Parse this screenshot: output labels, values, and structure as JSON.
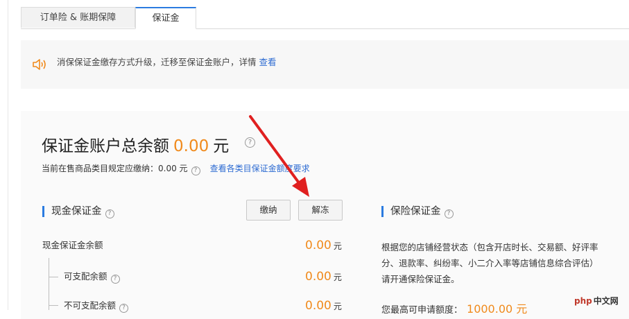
{
  "tabs": [
    {
      "label": "订单险 & 账期保障",
      "active": false
    },
    {
      "label": "保证金",
      "active": true
    }
  ],
  "notice": {
    "text": "消保保证金缴存方式升级，迁移至保证金账户，详情",
    "link": "查看"
  },
  "account": {
    "title": "保证金账户总余额",
    "amount": "0.00",
    "unit": "元",
    "required_label": "当前在售商品类目规定应缴纳：",
    "required_amount": "0.00 元",
    "requirement_link": "查看各类目保证金额度要求"
  },
  "cash_deposit": {
    "title": "现金保证金",
    "pay_button": "缴纳",
    "unfreeze_button": "解冻",
    "rows": [
      {
        "label": "现金保证金余额",
        "value": "0.00",
        "unit": "元"
      },
      {
        "label": "可支配余额",
        "value": "0.00",
        "unit": "元"
      },
      {
        "label": "不可支配余额",
        "value": "0.00",
        "unit": "元"
      }
    ]
  },
  "insurance_deposit": {
    "title": "保险保证金",
    "desc_lines": [
      "根据您的店铺经营状态（包含开店时长、交易额、好评率",
      "分、退款率、纠纷率、小二介入率等店铺信息综合评估）",
      "请开通保险保证金。"
    ],
    "quota_label": "您最高可申请额度：",
    "quota_value": "1000.00 元"
  },
  "watermark": {
    "a": "php",
    "b": "中文网"
  },
  "colors": {
    "accent": "#2b7be0",
    "amount": "#f08a1c",
    "link": "#2d6bd2",
    "annotation_arrow": "#e02020"
  }
}
